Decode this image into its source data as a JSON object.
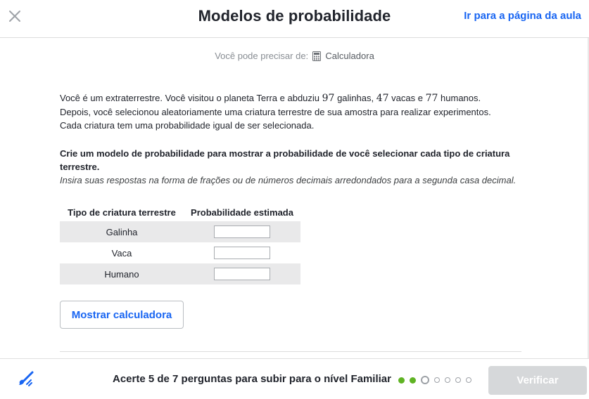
{
  "header": {
    "title": "Modelos de probabilidade",
    "lesson_link": "Ir para a página da aula"
  },
  "calc_hint": {
    "prefix": "Você pode precisar de:",
    "tool": "Calculadora"
  },
  "problem": {
    "part1": "Você é um extraterrestre. Você visitou o planeta Terra e abduziu ",
    "n_chickens": "97",
    "part2": " galinhas, ",
    "n_cows": "47",
    "part3": " vacas e ",
    "n_humans": "77",
    "part4": " humanos.",
    "line2": "Depois, você selecionou aleatoriamente uma criatura terrestre de sua amostra para realizar experimentos.",
    "line3": "Cada criatura tem uma probabilidade igual de ser selecionada."
  },
  "task": {
    "bold": "Crie um modelo de probabilidade para mostrar a probabilidade de você selecionar cada tipo de criatura terrestre.",
    "hint": "Insira suas respostas na forma de frações ou de números decimais arredondados para a segunda casa decimal."
  },
  "table": {
    "headers": [
      "Tipo de criatura terrestre",
      "Probabilidade estimada"
    ],
    "rows": [
      {
        "label": "Galinha",
        "value": ""
      },
      {
        "label": "Vaca",
        "value": ""
      },
      {
        "label": "Humano",
        "value": ""
      }
    ]
  },
  "calc_button": "Mostrar calculadora",
  "footer": {
    "goal": "Acerte 5 de 7 perguntas para subir para o nível Familiar",
    "progress": {
      "completed": 2,
      "current": 3,
      "total": 7
    },
    "verify": "Verificar"
  },
  "colors": {
    "accent": "#1865f2",
    "progress_done": "#5fb323",
    "button_disabled": "#d6d8da"
  },
  "icons": [
    "close-icon",
    "calculator-icon",
    "brush-icon"
  ]
}
